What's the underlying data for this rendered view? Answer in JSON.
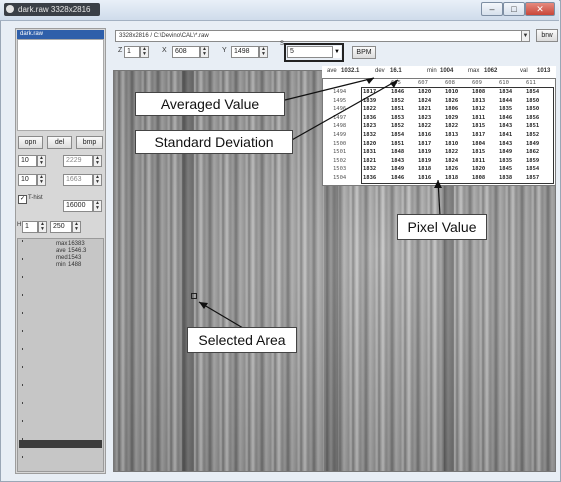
{
  "window": {
    "title": "dark.raw 3328x2816"
  },
  "toolbar": {
    "path": "3328x2816 / C:\\Devino\\CAL\\*.raw",
    "browse_label": "brw",
    "z_label": "Z",
    "z_value": "1",
    "x_label": "X",
    "x_value": "608",
    "y_label": "Y",
    "y_value": "1498",
    "s_label": "S",
    "s_value": "5",
    "bpm_label": "BPM"
  },
  "left_panel": {
    "list_header": "dark.raw",
    "opn_label": "opn",
    "del_label": "del",
    "bmp_label": "bmp",
    "min_left": "10",
    "min_right": "2229",
    "max_left": "10",
    "max_right": "1663",
    "thist_label": "T-hist",
    "thist_value": "16000",
    "h_label": "H",
    "h_left": "1",
    "h_right": "250",
    "stats": {
      "max_label": "max",
      "max_value": "16383",
      "ave_label": "ave",
      "ave_value": "1546.3",
      "med_label": "med",
      "med_value": "1543",
      "min_label": "min",
      "min_value": "1488"
    }
  },
  "stats_header": {
    "ave_label": "ave",
    "ave_value": "1032.1",
    "dev_label": "dev",
    "dev_value": "16.1",
    "min_label": "min",
    "min_value": "1004",
    "max_label": "max",
    "max_value": "1062",
    "val_label": "val",
    "val_value": "1013"
  },
  "table": {
    "cols": [
      "605",
      "607",
      "608",
      "609",
      "610",
      "611"
    ],
    "rows": [
      {
        "y": "1494",
        "v": [
          "1817",
          "1846",
          "1820",
          "1010",
          "1808",
          "1834",
          "1854"
        ]
      },
      {
        "y": "1495",
        "v": [
          "1839",
          "1852",
          "1824",
          "1826",
          "1813",
          "1844",
          "1850"
        ]
      },
      {
        "y": "1496",
        "v": [
          "1822",
          "1851",
          "1821",
          "1806",
          "1812",
          "1835",
          "1850"
        ]
      },
      {
        "y": "1497",
        "v": [
          "1836",
          "1853",
          "1823",
          "1029",
          "1811",
          "1846",
          "1856"
        ]
      },
      {
        "y": "1498",
        "v": [
          "1823",
          "1852",
          "1822",
          "1822",
          "1815",
          "1843",
          "1851"
        ]
      },
      {
        "y": "1499",
        "v": [
          "1832",
          "1854",
          "1816",
          "1813",
          "1817",
          "1841",
          "1852"
        ]
      },
      {
        "y": "1500",
        "v": [
          "1820",
          "1851",
          "1817",
          "1810",
          "1804",
          "1843",
          "1849"
        ]
      },
      {
        "y": "1501",
        "v": [
          "1831",
          "1848",
          "1819",
          "1822",
          "1815",
          "1849",
          "1862"
        ]
      },
      {
        "y": "1502",
        "v": [
          "1821",
          "1843",
          "1819",
          "1824",
          "1811",
          "1835",
          "1859"
        ]
      },
      {
        "y": "1503",
        "v": [
          "1832",
          "1849",
          "1818",
          "1826",
          "1820",
          "1845",
          "1854"
        ]
      },
      {
        "y": "1504",
        "v": [
          "1836",
          "1846",
          "1816",
          "1818",
          "1808",
          "1838",
          "1857"
        ]
      }
    ]
  },
  "annotations": {
    "averaged_value": "Averaged Value",
    "standard_deviation": "Standard Deviation",
    "pixel_value": "Pixel Value",
    "selected_area": "Selected Area"
  }
}
